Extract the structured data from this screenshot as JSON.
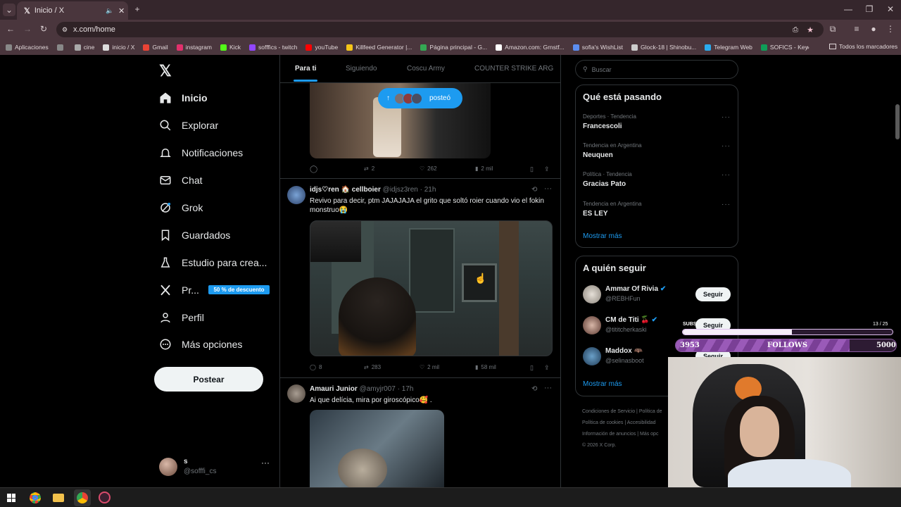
{
  "browser": {
    "tab_title": "Inicio / X",
    "url": "x.com/home",
    "bookmarks": [
      {
        "label": "Aplicaciones",
        "color": "#888"
      },
      {
        "label": "",
        "color": "#888"
      },
      {
        "label": "cine",
        "color": "#aaa"
      },
      {
        "label": "inicio / X",
        "color": "#ddd"
      },
      {
        "label": "Gmail",
        "color": "#ea4335"
      },
      {
        "label": "instagram",
        "color": "#e1306c"
      },
      {
        "label": "Kick",
        "color": "#53fc18"
      },
      {
        "label": "sofffics - twitch",
        "color": "#9146ff"
      },
      {
        "label": "youTube",
        "color": "#ff0000"
      },
      {
        "label": "Killfeed Generator |...",
        "color": "#f5c518"
      },
      {
        "label": "Página principal - G...",
        "color": "#34a853"
      },
      {
        "label": "Amazon.com: Grnstf...",
        "color": "#ffffff"
      },
      {
        "label": "sofia's WishList",
        "color": "#5b8def"
      },
      {
        "label": "Glock-18 | Shinobu...",
        "color": "#cccccc"
      },
      {
        "label": "Telegram Web",
        "color": "#2aabee"
      },
      {
        "label": "SOFICS - Key",
        "color": "#0f9d58"
      }
    ],
    "all_bookmarks": "Todos los marcadores"
  },
  "nav": {
    "items": [
      {
        "label": "Inicio",
        "icon": "home-icon"
      },
      {
        "label": "Explorar",
        "icon": "search-icon"
      },
      {
        "label": "Notificaciones",
        "icon": "bell-icon"
      },
      {
        "label": "Chat",
        "icon": "mail-icon"
      },
      {
        "label": "Grok",
        "icon": "grok-icon"
      },
      {
        "label": "Guardados",
        "icon": "bookmark-icon"
      },
      {
        "label": "Estudio para crea...",
        "icon": "flask-icon"
      },
      {
        "label": "Pr...",
        "icon": "x-icon"
      },
      {
        "label": "Perfil",
        "icon": "person-icon"
      },
      {
        "label": "Más opciones",
        "icon": "more-circle-icon"
      }
    ],
    "premium_badge": "50 % de descuento",
    "post_button": "Postear",
    "profile_name": "s",
    "profile_handle": "@sofffi_cs"
  },
  "feed": {
    "tabs": [
      "Para ti",
      "Siguiendo",
      "Coscu Army",
      "COUNTER STRIKE ARG"
    ],
    "posted_pill": "posteó",
    "tweet1": {
      "replies": "",
      "retweets": "2",
      "likes": "262",
      "views": "2 mil"
    },
    "tweet2": {
      "name": "idjs♡ren 🏠 cellboier",
      "handle": "@idjsz3ren",
      "time": "· 21h",
      "text": "Revivo para decir, ptm JAJAJAJA el grito que soltó roier cuando vio el fokin monstruo😭",
      "replies": "8",
      "retweets": "283",
      "likes": "2 mil",
      "views": "58 mil"
    },
    "tweet3": {
      "name": "Amauri Junior",
      "handle": "@amyjr007",
      "time": "· 17h",
      "text": "Ai que delícia, mira por giroscópico🥰 ."
    }
  },
  "right": {
    "search_placeholder": "Buscar",
    "trends_title": "Qué está pasando",
    "trends": [
      {
        "context": "Deportes · Tendencia",
        "name": "Francescoli"
      },
      {
        "context": "Tendencia en Argentina",
        "name": "Neuquen"
      },
      {
        "context": "Política · Tendencia",
        "name": "Gracias Pato"
      },
      {
        "context": "Tendencia en Argentina",
        "name": "ES LEY"
      }
    ],
    "show_more": "Mostrar más",
    "follow_title": "A quién seguir",
    "follow": [
      {
        "name": "Ammar Of Rivia",
        "handle": "@REBHFun",
        "button": "Seguir"
      },
      {
        "name": "CM de Titi 🍒",
        "handle": "@tititcherkaski",
        "button": "Seguir"
      },
      {
        "name": "Maddox 🦇",
        "handle": "@selinasboot",
        "button": "Seguir"
      }
    ],
    "follow_show_more": "Mostrar más",
    "footer": [
      "Condiciones de Servicio",
      "Política de",
      "Política de cookies",
      "Accesibilidad",
      "Información de anuncios",
      "Más opc",
      "© 2026 X Corp."
    ]
  },
  "overlay": {
    "subs_label": "SUBS",
    "subs_count": "13 / 25",
    "follows_current": "3953",
    "follows_label": "FOLLOWS",
    "follows_goal": "5000",
    "subs_progress": 0.52,
    "follows_progress": 0.79
  }
}
